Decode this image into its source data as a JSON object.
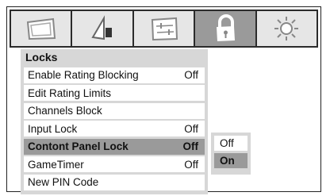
{
  "tabs": [
    {
      "icon": "picture-icon",
      "active": false
    },
    {
      "icon": "audio-icon",
      "active": false
    },
    {
      "icon": "settings-sliders-icon",
      "active": false
    },
    {
      "icon": "lock-icon",
      "active": true
    },
    {
      "icon": "sun-icon",
      "active": false
    }
  ],
  "menu": {
    "title": "Locks",
    "items": [
      {
        "label": "Enable Rating Blocking",
        "value": "Off"
      },
      {
        "label": "Edit Rating Limits",
        "value": ""
      },
      {
        "label": "Channels Block",
        "value": ""
      },
      {
        "label": "Input Lock",
        "value": "Off"
      },
      {
        "label": "Contont Panel Lock",
        "value": "Off"
      },
      {
        "label": "GameTimer",
        "value": "Off"
      },
      {
        "label": "New PIN Code",
        "value": ""
      }
    ]
  },
  "submenu": {
    "options": [
      "Off",
      "On"
    ]
  },
  "colors": {
    "tabbar_bg": "#2b2b2b",
    "panel_bg": "#d7d7d7",
    "highlight": "#9a9a9a"
  }
}
